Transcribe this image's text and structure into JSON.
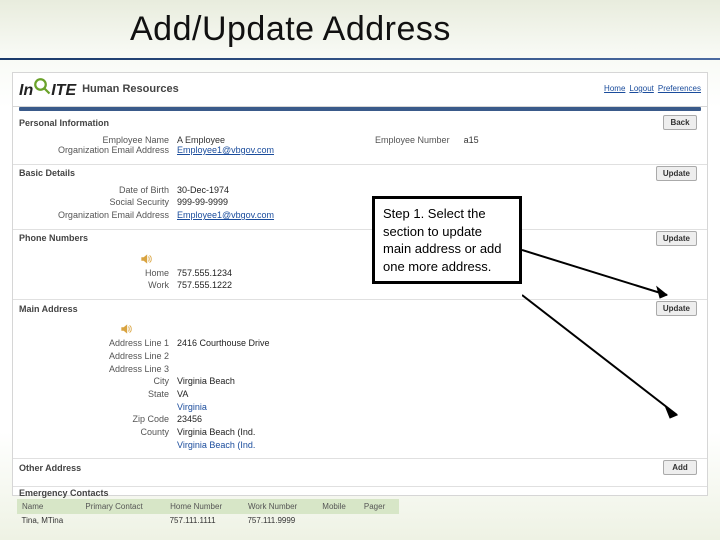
{
  "slide": {
    "title": "Add/Update Address"
  },
  "logo": {
    "app_name": "Human Resources"
  },
  "breadcrumb": {
    "a": "Home",
    "b": "Logout",
    "c": "Preferences"
  },
  "page": {
    "title": "Personal Information"
  },
  "buttons": {
    "back": "Back",
    "update": "Update",
    "add": "Add"
  },
  "identity": {
    "label_name": "Employee Name",
    "name": "A Employee",
    "label_email": "Organization Email Address",
    "email": "Employee1@vbgov.com",
    "label_num": "Employee Number",
    "num": "a15"
  },
  "sections": {
    "basic": "Basic Details",
    "phone": "Phone Numbers",
    "main_addr": "Main Address",
    "other_addr": "Other Address",
    "emergency": "Emergency Contacts"
  },
  "basic": {
    "label_dob": "Date of Birth",
    "dob": "30-Dec-1974",
    "label_ssn": "Social Security",
    "ssn": "999-99-9999",
    "label_email": "Organization Email Address",
    "email": "Employee1@vbgov.com"
  },
  "phone": {
    "label_home": "Home",
    "home": "757.555.1234",
    "label_work": "Work",
    "work": "757.555.1222"
  },
  "addr": {
    "label_l1": "Address Line 1",
    "l1": "2416 Courthouse Drive",
    "label_l2": "Address Line 2",
    "l2": "",
    "label_l3": "Address Line 3",
    "l3": "",
    "label_city": "City",
    "city": "Virginia Beach",
    "label_state": "State",
    "state": "VA",
    "state2": "Virginia",
    "label_zip": "Zip Code",
    "zip": "23456",
    "label_county": "County",
    "county": "Virginia Beach (Ind.",
    "county2": "Virginia Beach (Ind."
  },
  "contacts": {
    "h_name": "Name",
    "h_primary": "Primary Contact",
    "h_home": "Home Number",
    "h_work": "Work Number",
    "h_mobile": "Mobile",
    "h_pager": "Pager",
    "r1_name": "Tina, MTina",
    "r1_home": "757.111.1111",
    "r1_work": "757.111.9999"
  },
  "callout": {
    "text": "Step 1. Select the section to update main address or add one more address."
  }
}
